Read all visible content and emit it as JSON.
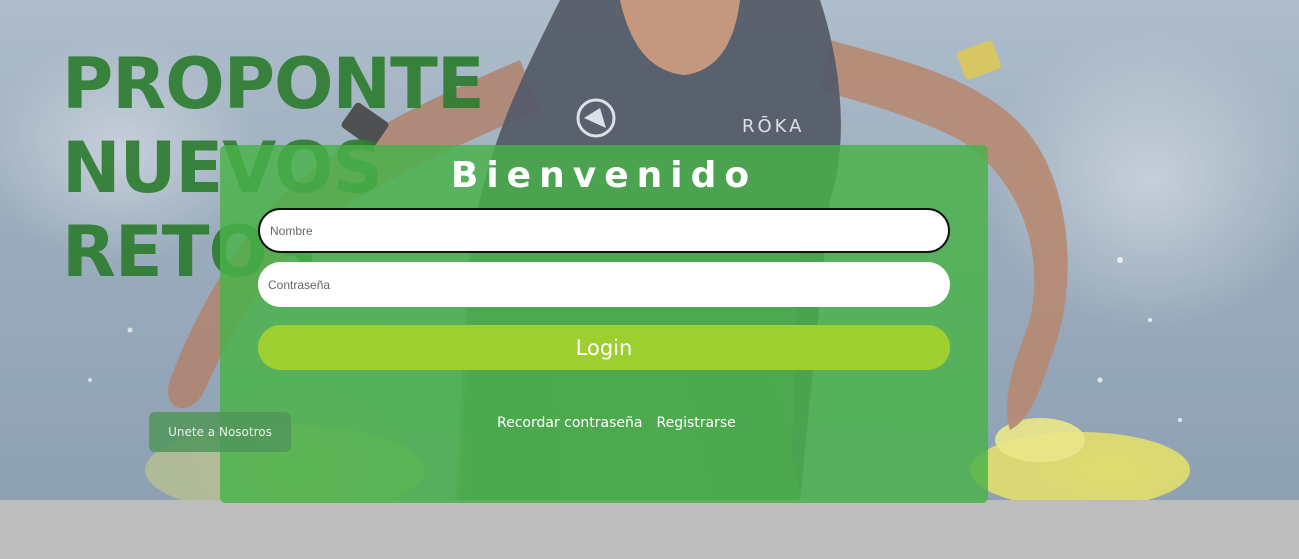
{
  "hero": {
    "headline_lines": [
      "PROPONTE",
      "NUEVOS",
      "RETOS"
    ],
    "join_button_label": "Unete a Nosotros",
    "background_image": "triathlete-running-out-of-water"
  },
  "login": {
    "title": "Bienvenido",
    "username_placeholder": "Nombre",
    "password_placeholder": "Contraseña",
    "submit_label": "Login",
    "remember_password_link": "Recordar contraseña",
    "register_link": "Registrarse"
  },
  "colors": {
    "headline": "#2e7d32",
    "panel": "#48b248",
    "login_button": "#9ccf2f",
    "footer_band": "#bdbdbd"
  }
}
